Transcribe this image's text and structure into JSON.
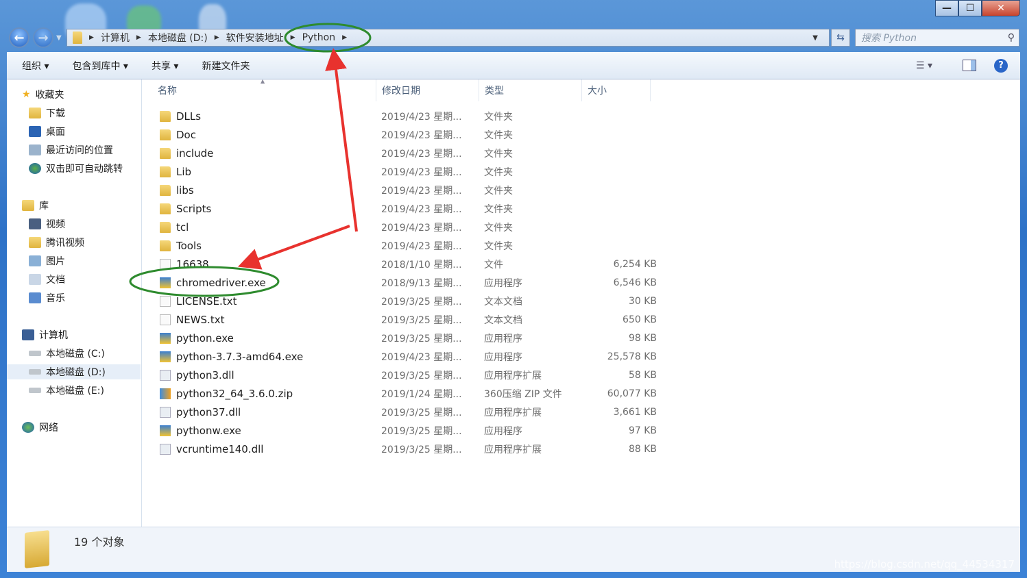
{
  "window": {
    "controls": [
      "minimize",
      "maximize",
      "close"
    ]
  },
  "address": {
    "crumbs": [
      "计算机",
      "本地磁盘 (D:)",
      "软件安装地址",
      "Python"
    ]
  },
  "search": {
    "placeholder": "搜索 Python"
  },
  "toolbar": {
    "organize": "组织 ▾",
    "include_library": "包含到库中 ▾",
    "share": "共享 ▾",
    "new_folder": "新建文件夹"
  },
  "sidebar": {
    "favorites": {
      "label": "收藏夹",
      "items": [
        "下载",
        "桌面",
        "最近访问的位置",
        "双击即可自动跳转"
      ]
    },
    "libraries": {
      "label": "库",
      "items": [
        "视频",
        "腾讯视频",
        "图片",
        "文档",
        "音乐"
      ]
    },
    "computer": {
      "label": "计算机",
      "items": [
        "本地磁盘 (C:)",
        "本地磁盘 (D:)",
        "本地磁盘 (E:)"
      ],
      "selected": "本地磁盘 (D:)"
    },
    "network": {
      "label": "网络"
    }
  },
  "columns": {
    "name": "名称",
    "date": "修改日期",
    "type": "类型",
    "size": "大小"
  },
  "files": [
    {
      "name": "DLLs",
      "date": "2019/4/23 星期...",
      "type": "文件夹",
      "size": "",
      "icon": "folder"
    },
    {
      "name": "Doc",
      "date": "2019/4/23 星期...",
      "type": "文件夹",
      "size": "",
      "icon": "folder"
    },
    {
      "name": "include",
      "date": "2019/4/23 星期...",
      "type": "文件夹",
      "size": "",
      "icon": "folder"
    },
    {
      "name": "Lib",
      "date": "2019/4/23 星期...",
      "type": "文件夹",
      "size": "",
      "icon": "folder"
    },
    {
      "name": "libs",
      "date": "2019/4/23 星期...",
      "type": "文件夹",
      "size": "",
      "icon": "folder"
    },
    {
      "name": "Scripts",
      "date": "2019/4/23 星期...",
      "type": "文件夹",
      "size": "",
      "icon": "folder"
    },
    {
      "name": "tcl",
      "date": "2019/4/23 星期...",
      "type": "文件夹",
      "size": "",
      "icon": "folder"
    },
    {
      "name": "Tools",
      "date": "2019/4/23 星期...",
      "type": "文件夹",
      "size": "",
      "icon": "folder"
    },
    {
      "name": "16638",
      "date": "2018/1/10 星期...",
      "type": "文件",
      "size": "6,254 KB",
      "icon": "doc"
    },
    {
      "name": "chromedriver.exe",
      "date": "2018/9/13 星期...",
      "type": "应用程序",
      "size": "6,546 KB",
      "icon": "exe"
    },
    {
      "name": "LICENSE.txt",
      "date": "2019/3/25 星期...",
      "type": "文本文档",
      "size": "30 KB",
      "icon": "doc"
    },
    {
      "name": "NEWS.txt",
      "date": "2019/3/25 星期...",
      "type": "文本文档",
      "size": "650 KB",
      "icon": "doc"
    },
    {
      "name": "python.exe",
      "date": "2019/3/25 星期...",
      "type": "应用程序",
      "size": "98 KB",
      "icon": "exe"
    },
    {
      "name": "python-3.7.3-amd64.exe",
      "date": "2019/4/23 星期...",
      "type": "应用程序",
      "size": "25,578 KB",
      "icon": "exe"
    },
    {
      "name": "python3.dll",
      "date": "2019/3/25 星期...",
      "type": "应用程序扩展",
      "size": "58 KB",
      "icon": "dll"
    },
    {
      "name": "python32_64_3.6.0.zip",
      "date": "2019/1/24 星期...",
      "type": "360压缩 ZIP 文件",
      "size": "60,077 KB",
      "icon": "zip"
    },
    {
      "name": "python37.dll",
      "date": "2019/3/25 星期...",
      "type": "应用程序扩展",
      "size": "3,661 KB",
      "icon": "dll"
    },
    {
      "name": "pythonw.exe",
      "date": "2019/3/25 星期...",
      "type": "应用程序",
      "size": "97 KB",
      "icon": "exe"
    },
    {
      "name": "vcruntime140.dll",
      "date": "2019/3/25 星期...",
      "type": "应用程序扩展",
      "size": "88 KB",
      "icon": "dll"
    }
  ],
  "status": {
    "count": "19 个对象"
  },
  "watermark": "https://blog.csdn.net/qq_44534317",
  "annotation_colors": {
    "ellipse": "#2e8b2e",
    "arrow": "#e8322e"
  }
}
